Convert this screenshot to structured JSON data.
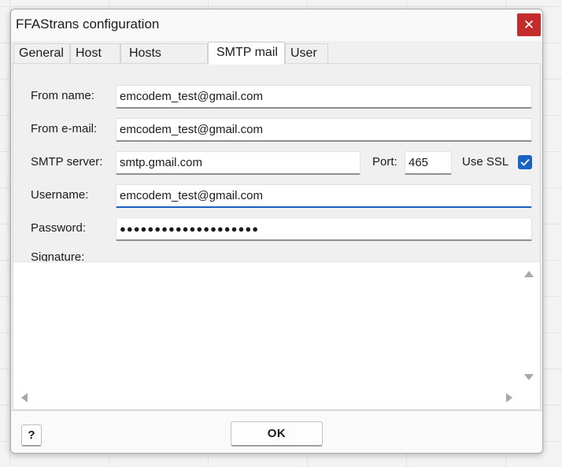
{
  "window": {
    "title": "FFAStrans configuration",
    "close_icon": "close-icon"
  },
  "tabs": [
    {
      "label": "General",
      "active": false
    },
    {
      "label": "Host",
      "active": false
    },
    {
      "label": "Hosts groups",
      "active": false
    },
    {
      "label": "SMTP mail",
      "active": true
    },
    {
      "label": "User",
      "active": false
    }
  ],
  "form": {
    "from_name_label": "From name:",
    "from_name_value": "emcodem_test@gmail.com",
    "from_email_label": "From e-mail:",
    "from_email_value": "emcodem_test@gmail.com",
    "smtp_server_label": "SMTP server:",
    "smtp_server_value": "smtp.gmail.com",
    "port_label": "Port:",
    "port_value": "465",
    "use_ssl_label": "Use SSL",
    "use_ssl_checked": true,
    "username_label": "Username:",
    "username_value": "emcodem_test@gmail.com",
    "password_label": "Password:",
    "password_value": "●●●●●●●●●●●●●●●●●●●●",
    "signature_label": "Signature:",
    "signature_value": ""
  },
  "buttons": {
    "help": "?",
    "ok": "OK"
  },
  "colors": {
    "accent": "#1a63c3",
    "close": "#c42b2b"
  }
}
